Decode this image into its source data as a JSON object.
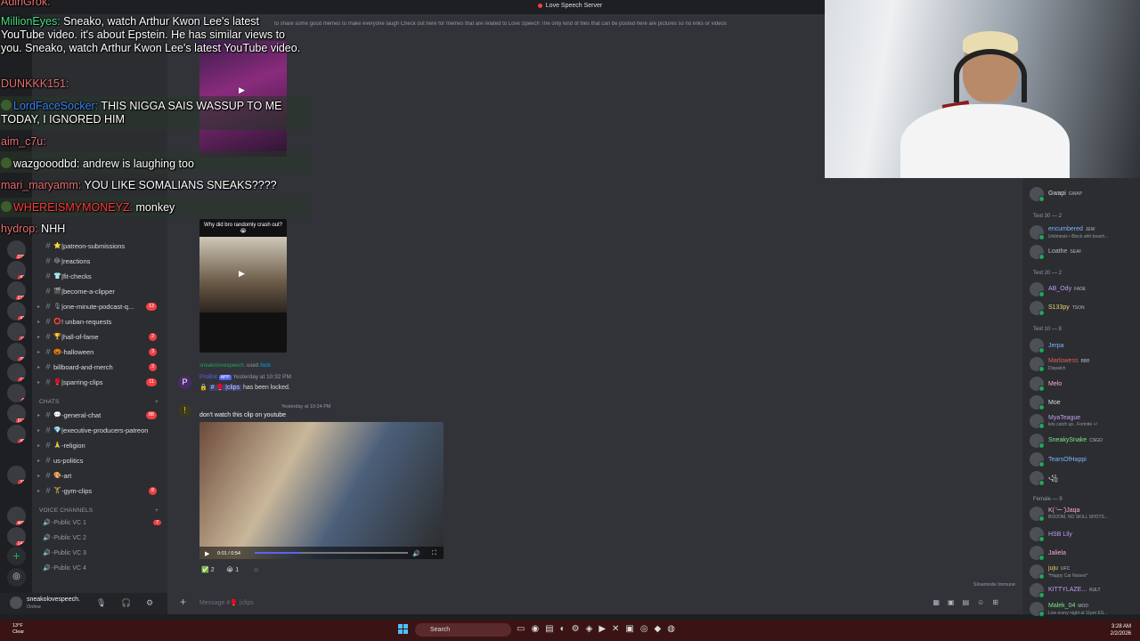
{
  "window": {
    "title": "Love Speech Server"
  },
  "topic": "to share some good memes to make everyone laugh Check out here for memes that are related to Love Speech The only kind of files that can be posted here are pictures so no links or videos",
  "servers": [
    {
      "badge": "276"
    },
    {
      "badge": "47"
    },
    {
      "badge": "231"
    },
    {
      "badge": "41"
    },
    {
      "badge": "11"
    },
    {
      "badge": "28"
    },
    {
      "badge": "14"
    },
    {
      "badge": "9"
    },
    {
      "badge": "512"
    },
    {
      "badge": "49"
    },
    {
      "badge": "31"
    },
    {
      "badge": "469"
    },
    {
      "badge": "147"
    }
  ],
  "channels": [
    {
      "icon": "⭐",
      "label": "|patreon-submissions",
      "unread": ""
    },
    {
      "icon": "😂",
      "label": "|reactions",
      "unread": ""
    },
    {
      "icon": "👕",
      "label": "|fit-checks",
      "unread": ""
    },
    {
      "icon": "🎬",
      "label": "|become-a-clipper",
      "unread": ""
    },
    {
      "icon": "🎙",
      "label": "|one-minute-podcast-q...",
      "unread": "13"
    },
    {
      "icon": "⭕",
      "label": "! unban-requests",
      "unread": ""
    },
    {
      "icon": "🏆",
      "label": "|hall-of-fame",
      "unread": "2"
    },
    {
      "icon": "🎃",
      "label": "-halloween",
      "unread": "3"
    },
    {
      "icon": "",
      "label": "billboard-and-merch",
      "unread": "3"
    },
    {
      "icon": "🥊",
      "label": "|sparring-clips",
      "unread": "11"
    }
  ],
  "chats_category": "CHATS",
  "chat_channels": [
    {
      "icon": "💬",
      "label": "-general-chat",
      "unread": "88"
    },
    {
      "icon": "💎",
      "label": "|executive-producers-patreon",
      "unread": ""
    },
    {
      "icon": "🙏",
      "label": "-religion",
      "unread": ""
    },
    {
      "icon": "",
      "label": "us-politics",
      "unread": ""
    },
    {
      "icon": "🎨",
      "label": "-art",
      "unread": ""
    },
    {
      "icon": "🏋",
      "label": "-gym-clips",
      "unread": "8"
    }
  ],
  "voice_category": "VOICE CHANNELS",
  "voice_channels": [
    {
      "label": "-Public VC 1",
      "unread": "7"
    },
    {
      "label": "-Public VC 2",
      "unread": ""
    },
    {
      "label": "-Public VC 3",
      "unread": ""
    },
    {
      "label": "-Public VC 4",
      "unread": ""
    }
  ],
  "user": {
    "name": "sneakolovespeech.",
    "status": "Online"
  },
  "messages": {
    "media2_caption": "Why did bro randomly crash out? 😭",
    "system_user": "sneakolovespeech.",
    "system_action": "used",
    "system_command": "/lock",
    "bot_name": "ProBot",
    "bot_tag": "APP",
    "bot_time": "Yesterday at 10:32 PM",
    "bot_text_pre": "🔒",
    "bot_channel": "# 🥊 |clips",
    "bot_text_post": "has been locked.",
    "msg_time": "Yesterday at 10:34 PM",
    "msg_text": "don't watch this clip on youtube",
    "video_time": "0:01 / 0:54",
    "reaction1_emoji": "✅",
    "reaction1_count": "2",
    "reaction2_emoji": "😭",
    "reaction2_count": "1"
  },
  "composer": {
    "placeholder": "Message #🥊 |clips"
  },
  "slowmode": "Slowmode Immune",
  "member_groups": [
    {
      "label": "Text 30 — 2"
    },
    {
      "label": "Text 20 — 2"
    },
    {
      "label": "Text 10 — 8"
    },
    {
      "label": "Female — 9"
    }
  ],
  "members": [
    {
      "name": "Gwapi",
      "tag": "GWAP",
      "status": "",
      "color": "#dbdee1"
    },
    {
      "name": "encumbered",
      "tag": "JEW",
      "status": "Unlimesis • Block ahh beach...",
      "color": "#7ab4ff"
    },
    {
      "name": "Loathe",
      "tag": "SEAF",
      "status": "",
      "color": "#b5bac1"
    },
    {
      "name": "AB_Ody",
      "tag": "FADE",
      "status": "",
      "color": "#c39bf5"
    },
    {
      "name": "S133py",
      "tag": "TSON",
      "status": "",
      "color": "#f0d06b"
    },
    {
      "name": "Jerpa",
      "tag": "",
      "status": "",
      "color": "#7ab4ff"
    },
    {
      "name": "Marlowess",
      "tag": "BBB",
      "status": "Dispatch",
      "color": "#e35f5f"
    },
    {
      "name": "Melo",
      "tag": "",
      "status": "",
      "color": "#ffa8d9"
    },
    {
      "name": "Moe",
      "tag": "",
      "status": "",
      "color": "#dbdee1"
    },
    {
      "name": "MyaTeague",
      "tag": "",
      "status": "lets catch up.. Fortnite +!",
      "color": "#c39bf5"
    },
    {
      "name": "SneakySnake",
      "tag": "CSGO",
      "status": "",
      "color": "#7ee787"
    },
    {
      "name": "TearsOfHappi",
      "tag": "",
      "status": "",
      "color": "#7ab4ff"
    },
    {
      "name": "꧁",
      "tag": "",
      "status": "",
      "color": "#dbdee1"
    },
    {
      "name": "K( ̄ー ̄)Jaqa",
      "tag": "",
      "status": "BOOOM, NO SKILL SHOTS...",
      "color": "#ffa8d9"
    },
    {
      "name": "HSB Lily",
      "tag": "",
      "status": "",
      "color": "#c39bf5"
    },
    {
      "name": "Jaliela",
      "tag": "",
      "status": "",
      "color": "#ffa8d9"
    },
    {
      "name": "juju",
      "tag": "UFC",
      "status": "*Happy Cat Noises*",
      "color": "#f0d06b"
    },
    {
      "name": "KITTYLAZE...",
      "tag": "KULT",
      "status": "",
      "color": "#c39bf5"
    },
    {
      "name": "Malek_04",
      "tag": "MOD",
      "status": "Live every night at 11pm ES...",
      "color": "#7ee787"
    }
  ],
  "overlay": [
    {
      "user": "AdinGrok:",
      "text": "",
      "color": "#e86f6f"
    },
    {
      "user": "MillionEyes:",
      "text": " Sneako, watch Arthur Kwon Lee's latest YouTube video. it's about Epstein. He has similar views to you. Sneako, watch Arthur Kwon Lee's latest YouTube video.",
      "color": "#4ade80"
    },
    {
      "user": "DUNKKK151:",
      "text": "",
      "color": "#e86f6f"
    },
    {
      "user": "LordFaceSocker:",
      "text": " THIS NIGGA SAIS WASSUP TO ME TODAY, I IGNORED HIM",
      "color": "#3b82f6"
    },
    {
      "user": "aim_c7u:",
      "text": "",
      "color": "#e86f6f"
    },
    {
      "user": "wazgooodbd:",
      "text": " andrew is laughing too",
      "color": "#ffffff"
    },
    {
      "user": "mari_maryamm:",
      "text": " YOU LIKE SOMALIANS SNEAKS????",
      "color": "#e86f6f"
    },
    {
      "user": "WHEREISMYMONEYZ:",
      "text": " monkey",
      "color": "#ff3b3b"
    },
    {
      "user": "hydrop:",
      "text": " NHH",
      "color": "#e86f6f"
    }
  ],
  "taskbar": {
    "temp": "13°F",
    "weather": "Clear",
    "search": "Search",
    "time": "3:28 AM",
    "date": "2/2/2026"
  }
}
